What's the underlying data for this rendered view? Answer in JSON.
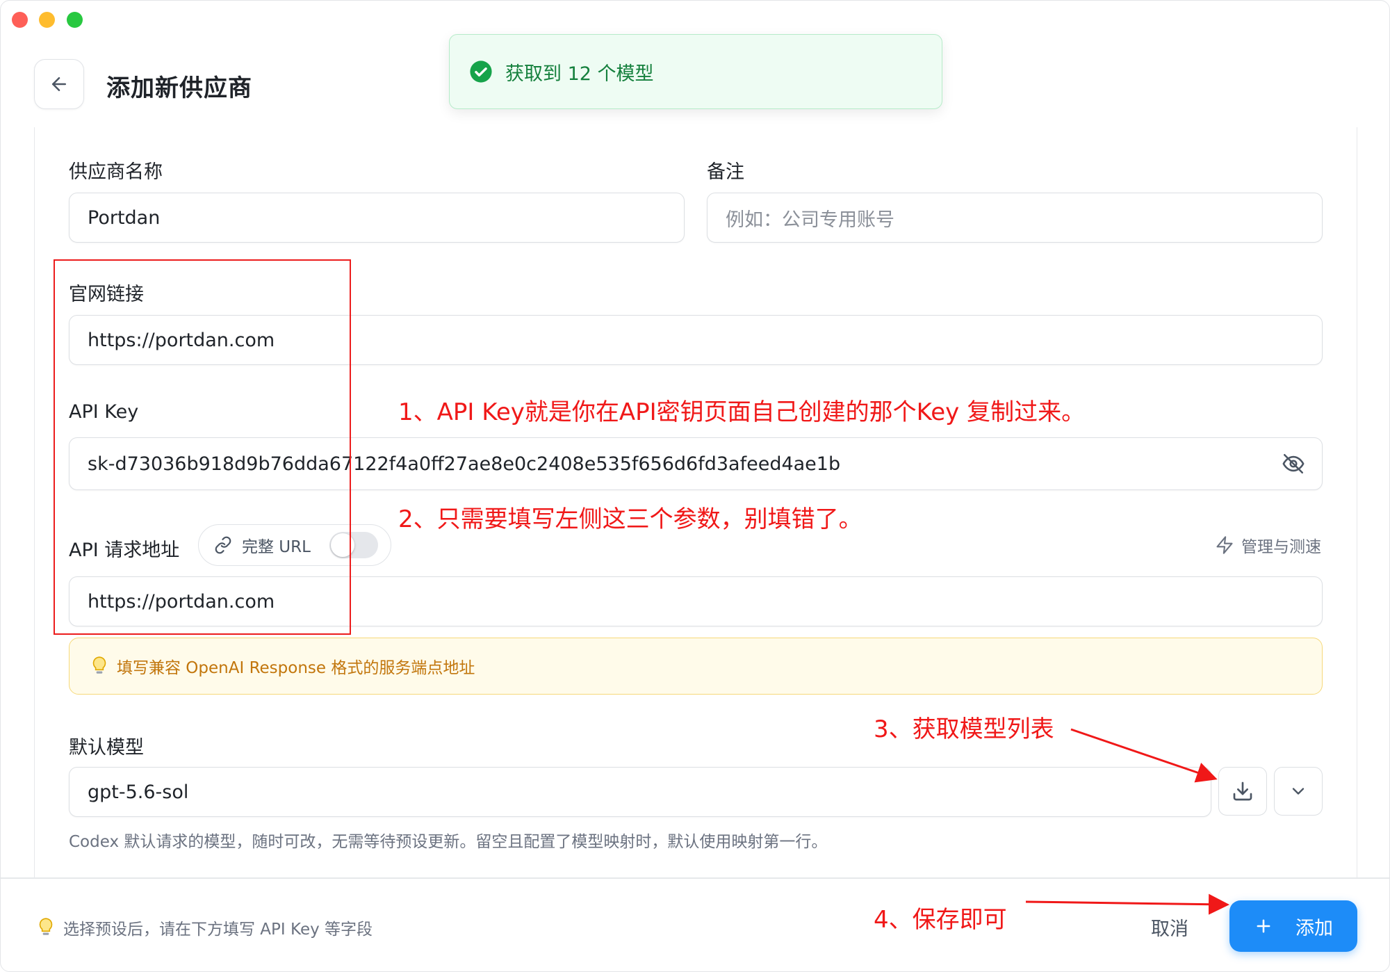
{
  "header": {
    "title": "添加新供应商",
    "back_icon": "arrow-left-icon"
  },
  "toast": {
    "message": "获取到 12 个模型",
    "icon": "check-circle-icon",
    "color": "#16a34a"
  },
  "form": {
    "provider_name": {
      "label": "供应商名称",
      "value": "Portdan"
    },
    "notes": {
      "label": "备注",
      "placeholder": "例如：公司专用账号"
    },
    "website": {
      "label": "官网链接",
      "value": "https://portdan.com"
    },
    "api_key": {
      "label": "API Key",
      "value": "sk-d73036b918d9b76dda67122f4a0ff27ae8e0c2408e535f656d6fd3afeed4ae1b",
      "toggle_icon": "eye-off-icon"
    },
    "endpoint": {
      "label": "API 请求地址",
      "full_url_toggle": {
        "label": "完整 URL",
        "enabled": false
      },
      "manage_label": "管理与测速",
      "value": "https://portdan.com"
    },
    "endpoint_tip": "填写兼容 OpenAI Response 格式的服务端点地址",
    "default_model": {
      "label": "默认模型",
      "value": "gpt-5.6-sol",
      "help": "Codex 默认请求的模型，随时可改，无需等待预设更新。留空且配置了模型映射时，默认使用映射第一行。"
    }
  },
  "footer": {
    "hint": "选择预设后，请在下方填写 API Key 等字段",
    "cancel_label": "取消",
    "add_label": "添加"
  },
  "annotations": {
    "note1": "1、API Key就是你在API密钥页面自己创建的那个Key 复制过来。",
    "note2": "2、只需要填写左侧这三个参数，别填错了。",
    "note3": "3、获取模型列表",
    "note4": "4、保存即可",
    "color": "#f01818"
  },
  "colors": {
    "accent": "#1d8cf8",
    "success": "#15803d",
    "warning_text": "#c2760c",
    "annotation": "#f01818"
  }
}
